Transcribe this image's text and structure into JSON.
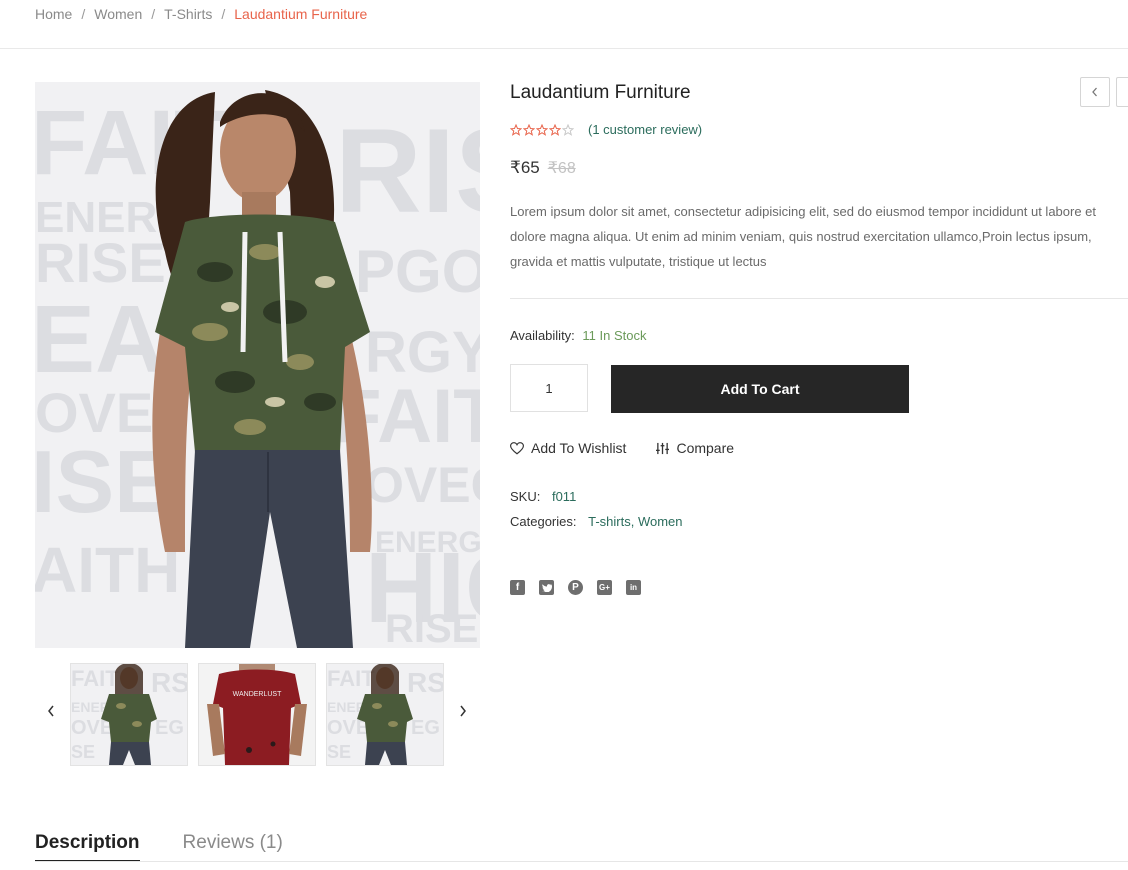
{
  "breadcrumb": {
    "items": [
      "Home",
      "Women",
      "T-Shirts"
    ],
    "separator": "/",
    "current": "Laudantium Furniture"
  },
  "product": {
    "title": "Laudantium Furniture",
    "rating": {
      "value": 4,
      "max": 5,
      "review_link": "(1 customer review)"
    },
    "price": {
      "current": "₹65",
      "original": "₹68"
    },
    "description": "Lorem ipsum dolor sit amet, consectetur adipisicing elit, sed do eiusmod tempor incididunt ut labore et dolore magna aliqua. Ut enim ad minim veniam, quis nostrud exercitation ullamco,Proin lectus ipsum, gravida et mattis vulputate, tristique ut lectus",
    "availability": {
      "label": "Availability:",
      "value": "11 In Stock"
    },
    "quantity": "1",
    "add_to_cart": "Add To Cart",
    "wishlist": "Add To Wishlist",
    "compare": "Compare",
    "sku": {
      "label": "SKU:",
      "value": "f011"
    },
    "categories": {
      "label": "Categories:",
      "value": "T-shirts, Women"
    }
  },
  "gallery": {
    "thumbnails": [
      "camo-hoodie-front",
      "red-wanderlust-tee",
      "camo-hoodie-front"
    ]
  },
  "social": [
    "facebook-icon",
    "twitter-icon",
    "pinterest-icon",
    "google-plus-icon",
    "linkedin-icon"
  ],
  "tabs": [
    {
      "label": "Description",
      "active": true
    },
    {
      "label": "Reviews (1)",
      "active": false
    }
  ],
  "colors": {
    "accent": "#e8644b",
    "link": "#2b6c5c",
    "stock": "#6b9a5a",
    "button": "#262626"
  }
}
